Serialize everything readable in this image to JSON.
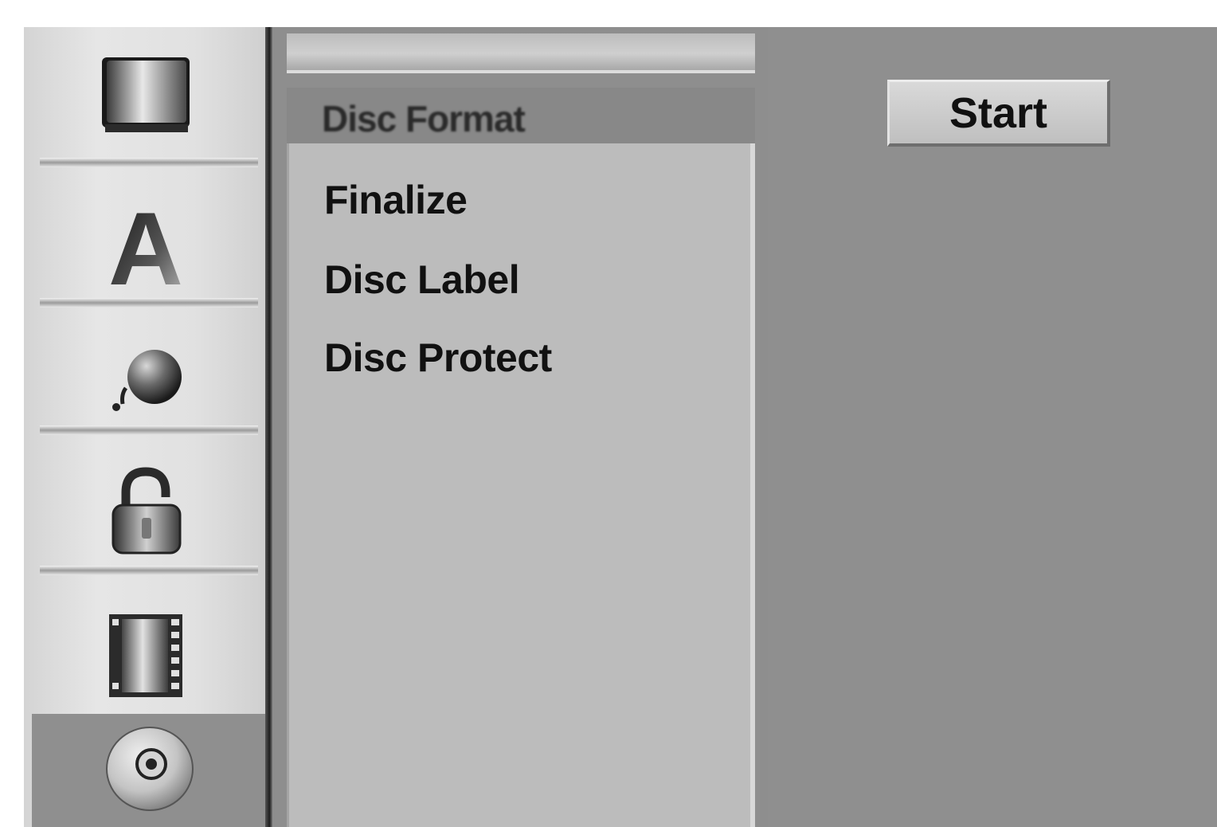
{
  "categories": [
    {
      "name": "tv-icon",
      "selected": false
    },
    {
      "name": "language-icon",
      "selected": false
    },
    {
      "name": "audio-icon",
      "selected": false
    },
    {
      "name": "lock-icon",
      "selected": false
    },
    {
      "name": "film-icon",
      "selected": false
    },
    {
      "name": "disc-icon",
      "selected": true
    }
  ],
  "category_letter": "A",
  "submenu": {
    "header": "Disc Format",
    "items": [
      "Finalize",
      "Disc Label",
      "Disc Protect"
    ]
  },
  "action": {
    "start_label": "Start"
  }
}
